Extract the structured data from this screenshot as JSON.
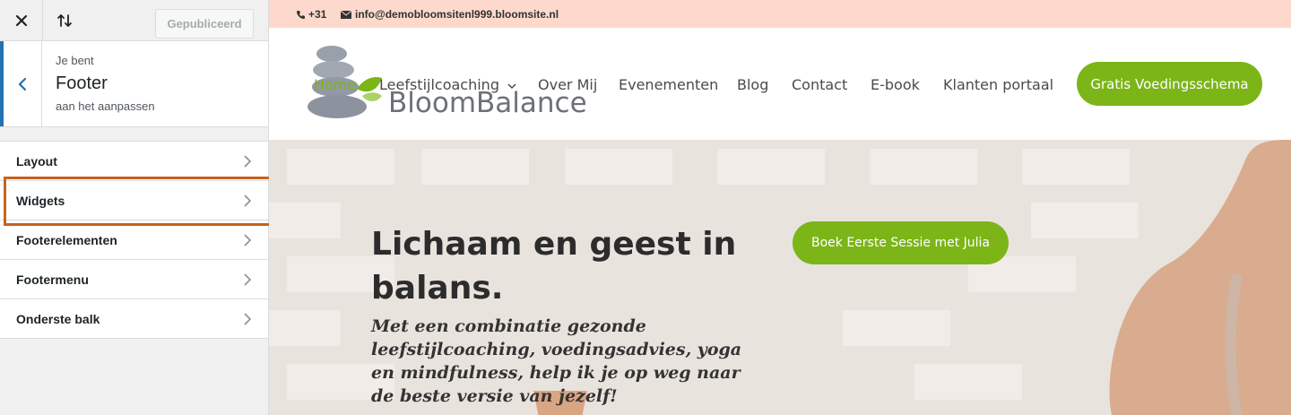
{
  "customizer": {
    "close_icon": "close-icon",
    "sort_icon": "sort-arrows-icon",
    "publish_label": "Gepubliceerd",
    "section": {
      "prefix": "Je bent",
      "title": "Footer",
      "suffix": "aan het aanpassen"
    },
    "menu": [
      {
        "label": "Layout"
      },
      {
        "label": "Widgets",
        "highlighted": true
      },
      {
        "label": "Footerelementen"
      },
      {
        "label": "Footermenu"
      },
      {
        "label": "Onderste balk"
      }
    ]
  },
  "site": {
    "topbar": {
      "phone": "+31",
      "email": "info@demobloomsitenl999.bloomsite.nl"
    },
    "logo_text": "BloomBalance",
    "nav": [
      {
        "label": "Home",
        "active": true
      },
      {
        "label": "Leefstijlcoaching",
        "has_dropdown": true
      },
      {
        "label": "Over Mij"
      },
      {
        "label": "Evenementen"
      },
      {
        "label": "Blog"
      },
      {
        "label": "Contact"
      },
      {
        "label": "E-book"
      },
      {
        "label": "Klanten portaal"
      }
    ],
    "cta": "Gratis Voedingsschema",
    "hero": {
      "title": "Lichaam en geest in balans.",
      "subtitle": "Met een combinatie gezonde leefstijlcoaching, voedingsadvies, yoga en mindfulness, help ik je op weg naar de beste versie van jezelf!",
      "button": "Boek Eerste Sessie met Julia"
    },
    "colors": {
      "accent": "#7cb518",
      "topbar_bg": "#fcd9cc",
      "highlight": "#c8621b",
      "wp_blue": "#2271b1"
    }
  }
}
